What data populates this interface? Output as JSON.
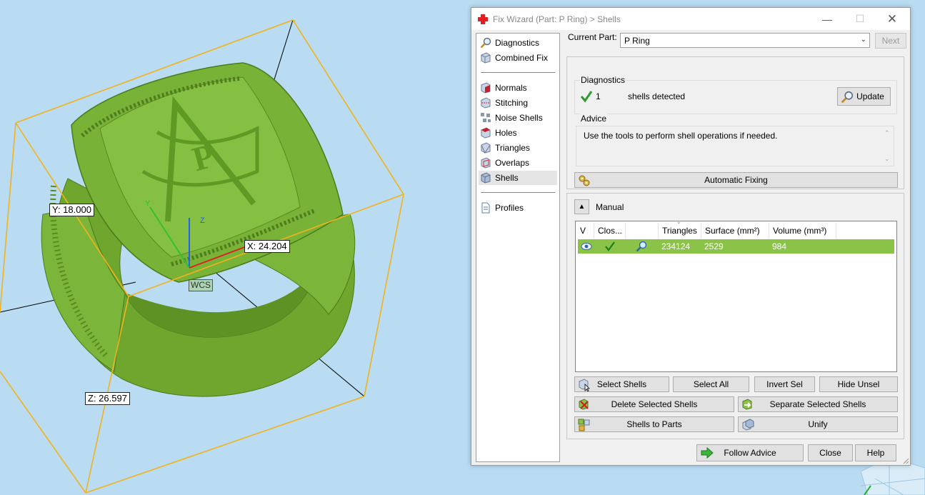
{
  "viewport": {
    "labels": {
      "y_dim": "Y: 18.000",
      "x_dim": "X: 24.204",
      "z_dim": "Z: 26.597",
      "wcs": "WCS"
    },
    "colors": {
      "background": "#b9dcf3",
      "model": "#7cb83a",
      "bbox": "#f2b21c"
    }
  },
  "window": {
    "title": "Fix Wizard (Part: P Ring) > Shells",
    "controls": {
      "minimize": "—",
      "maximize": "☐",
      "close": "✕"
    }
  },
  "nav": {
    "items": [
      {
        "label": "Diagnostics",
        "icon": "magnifier-icon"
      },
      {
        "label": "Combined Fix",
        "icon": "cube-icon"
      },
      {
        "label": "Normals",
        "icon": "normals-cube-icon"
      },
      {
        "label": "Stitching",
        "icon": "stitching-cube-icon"
      },
      {
        "label": "Noise Shells",
        "icon": "noise-shells-icon"
      },
      {
        "label": "Holes",
        "icon": "holes-cube-icon"
      },
      {
        "label": "Triangles",
        "icon": "triangles-cube-icon"
      },
      {
        "label": "Overlaps",
        "icon": "overlaps-cube-icon"
      },
      {
        "label": "Shells",
        "icon": "shells-cube-icon",
        "selected": true
      },
      {
        "label": "Profiles",
        "icon": "document-icon"
      }
    ]
  },
  "part": {
    "label": "Current Part:",
    "value": "P Ring",
    "next": "Next"
  },
  "diagnostics": {
    "title": "Diagnostics",
    "count": "1",
    "text": "shells detected",
    "update": "Update"
  },
  "advice": {
    "title": "Advice",
    "text": "Use the tools to perform shell operations if needed."
  },
  "automatic_fixing": "Automatic Fixing",
  "manual": {
    "title": "Manual",
    "columns": [
      "V",
      "Clos...",
      "",
      "Triangles",
      "Surface (mm²)",
      "Volume (mm³)"
    ],
    "rows": [
      {
        "triangles": "234124",
        "surface": "2529",
        "volume": "984"
      }
    ],
    "buttons": {
      "select_shells": "Select Shells",
      "select_all": "Select All",
      "invert_sel": "Invert Sel",
      "hide_unsel": "Hide Unsel",
      "delete_selected": "Delete Selected Shells",
      "separate_selected": "Separate Selected Shells",
      "shells_to_parts": "Shells to Parts",
      "unify": "Unify"
    }
  },
  "footer": {
    "follow_advice": "Follow Advice",
    "close": "Close",
    "help": "Help"
  }
}
